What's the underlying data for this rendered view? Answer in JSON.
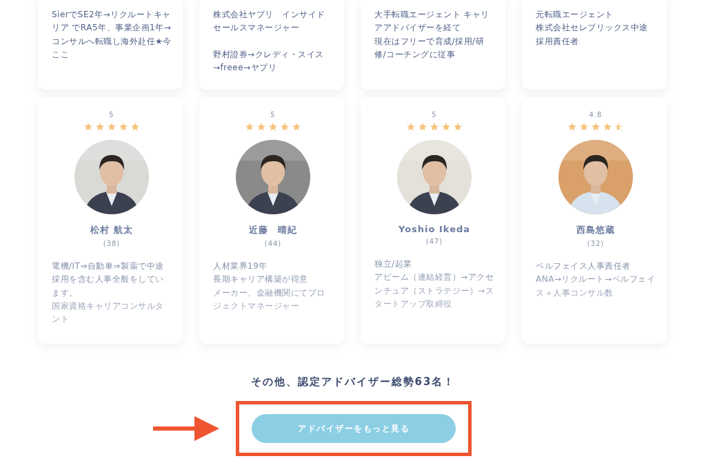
{
  "top_cards": [
    {
      "bio": [
        [
          "SierでSE2年→リクルートキャリア でRA5年、事業企画1年→コンサルへ転職し海外赴任★今ここ"
        ]
      ]
    },
    {
      "bio": [
        [
          "株式会社ヤプリ　インサイドセールスマネージャー"
        ],
        [
          "野村證券→クレディ・スイス→freee→ヤプリ"
        ]
      ]
    },
    {
      "bio": [
        [
          "大手転職エージェント キャリアアドバイザーを経て",
          "現在はフリーで育成/採用/研修/コーチングに従事"
        ]
      ]
    },
    {
      "bio": [
        [
          "元転職エージェント",
          "株式会社セレブリックス中途採用責任者"
        ]
      ]
    }
  ],
  "advisors": [
    {
      "rating": "5",
      "stars": 5,
      "photo": {
        "kind": "picture"
      },
      "name": "松村 航太",
      "age": "(38)",
      "bio": [
        "電機/IT⇒自動車⇒製薬で中途採用を含む人事全般をしています。",
        "国家資格キャリアコンサルタント"
      ]
    },
    {
      "rating": "5",
      "stars": 5,
      "photo": {
        "kind": "picture"
      },
      "name": "近藤　晴紀",
      "age": "(44)",
      "bio": [
        "人材業界19年",
        "長期キャリア構築が得意",
        "メーカー、金融機関にてプロジェクトマネージャー"
      ]
    },
    {
      "rating": "5",
      "stars": 5,
      "photo": {
        "kind": "picture"
      },
      "name": "Yoshio Ikeda",
      "age": "(47)",
      "bio": [
        "独立/起業",
        "アビーム（連結経営）→アクセンチュア（ストラテジー）→スタートアップ取締役"
      ]
    },
    {
      "rating": "4.8",
      "stars": 4.5,
      "photo": {
        "kind": "picture"
      },
      "name": "西島悠蔵",
      "age": "(32)",
      "bio": [
        "ベルフェイス人事責任者",
        "ANA→リクルート→ベルフェイス＋人事コンサル数"
      ]
    }
  ],
  "summary": "その他、認定アドバイザー総勢63名！",
  "more_button": {
    "label": "アドバイザーをもっと見る"
  }
}
